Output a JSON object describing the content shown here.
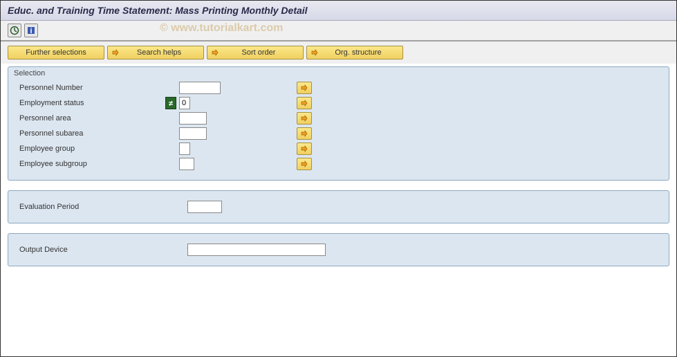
{
  "title": "Educ. and Training Time Statement: Mass Printing Monthly Detail",
  "watermark": "© www.tutorialkart.com",
  "buttons": {
    "further_selections": "Further selections",
    "search_helps": "Search helps",
    "sort_order": "Sort order",
    "org_structure": "Org. structure"
  },
  "selection": {
    "title": "Selection",
    "fields": {
      "personnel_number": {
        "label": "Personnel Number",
        "value": ""
      },
      "employment_status": {
        "label": "Employment status",
        "value": "0"
      },
      "personnel_area": {
        "label": "Personnel area",
        "value": ""
      },
      "personnel_subarea": {
        "label": "Personnel subarea",
        "value": ""
      },
      "employee_group": {
        "label": "Employee group",
        "value": ""
      },
      "employee_subgroup": {
        "label": "Employee subgroup",
        "value": ""
      }
    }
  },
  "evaluation_period": {
    "label": "Evaluation Period",
    "value": ""
  },
  "output_device": {
    "label": "Output Device",
    "value": ""
  }
}
